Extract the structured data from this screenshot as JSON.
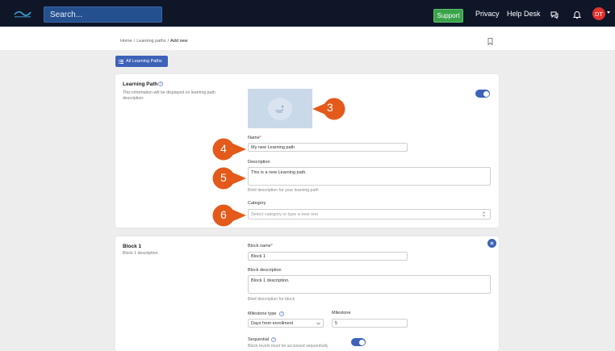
{
  "topbar": {
    "search_placeholder": "Search...",
    "support_label": "Support",
    "privacy_label": "Privacy",
    "helpdesk_label": "Help Desk",
    "avatar_initials": "DT"
  },
  "breadcrumb": {
    "home": "Home",
    "sep1": "/",
    "paths": "Learning paths",
    "sep2": "/",
    "current": "Add new"
  },
  "toolbar": {
    "all_paths_label": "All Learning Paths"
  },
  "learning_path": {
    "title": "Learning Path",
    "description": "This information will be displayed on learning path description.",
    "name_label": "Name",
    "name_required": "*",
    "name_value": "My new Learning path",
    "desc_label": "Description",
    "desc_value": "This is a new Learning path.",
    "desc_hint": "Brief description for your learning path",
    "category_label": "Category",
    "category_placeholder": "Select category or type a new one",
    "enabled": true
  },
  "block": {
    "title": "Block 1",
    "description": "Block 1 description.",
    "name_label": "Block name",
    "name_required": "*",
    "name_value": "Block 1",
    "desc_label": "Block description",
    "desc_value": "Block 1 description.",
    "desc_hint": "Brief description for block",
    "milestone_type_label": "Milestone type",
    "milestone_type_value": "Days from enrollment",
    "milestone_label": "Milestone",
    "milestone_value": "5",
    "sequential_label": "Sequential",
    "sequential_hint": "Block levels must be accessed sequentially",
    "sequential_enabled": true
  },
  "callouts": [
    "3",
    "4",
    "5",
    "6"
  ],
  "colors": {
    "topbar": "#0f1628",
    "accent": "#3d62b8",
    "support": "#3aa34a",
    "callout": "#e35a1b",
    "avatar": "#e2312f"
  }
}
